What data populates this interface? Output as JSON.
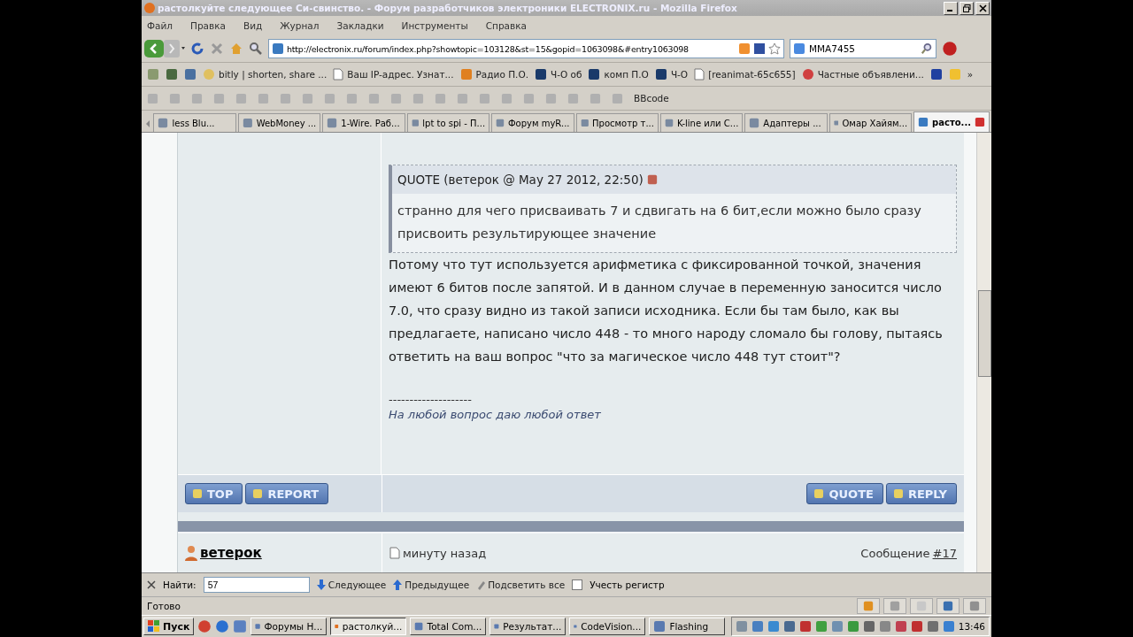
{
  "window": {
    "title": "растолкуйте следующее Си-свинство. - Форум разработчиков электроники ELECTRONIX.ru - Mozilla Firefox"
  },
  "menu": [
    "Файл",
    "Правка",
    "Вид",
    "Журнал",
    "Закладки",
    "Инструменты",
    "Справка"
  ],
  "nav": {
    "url": "http://electronix.ru/forum/index.php?showtopic=103128&st=15&gopid=1063098&#entry1063098",
    "search": "MMA7455"
  },
  "bookmarks": [
    "bitly | shorten, share ...",
    "Ваш IP-адрес. Узнат...",
    "Радио П.О.",
    "Ч-О  об",
    "комп П.О",
    "Ч-О",
    "[reanimat-65c655]",
    "Частные объявлени..."
  ],
  "bookmarks_more": "»",
  "format_toolbar": {
    "bbcode": "BBcode"
  },
  "tabs": [
    {
      "label": "less Blu...",
      "selected": false
    },
    {
      "label": "WebMoney ...",
      "selected": false
    },
    {
      "label": "1-Wire. Раб...",
      "selected": false
    },
    {
      "label": "lpt to spi - П...",
      "selected": false
    },
    {
      "label": "Форум myR...",
      "selected": false
    },
    {
      "label": "Просмотр т...",
      "selected": false
    },
    {
      "label": "K-line или C...",
      "selected": false
    },
    {
      "label": "Адаптеры ...",
      "selected": false
    },
    {
      "label": "Омар Хайям...",
      "selected": false
    },
    {
      "label": "расто...",
      "selected": true
    }
  ],
  "post": {
    "quote_header": "QUOTE (ветерок @ May 27 2012, 22:50)",
    "quote_text": "странно для чего присваивать 7 и сдвигать на 6 бит,если можно было сразу присвоить результирующее значение",
    "body": "Потому что тут используется арифметика с фиксированной точкой, значения имеют 6 битов после запятой. И в данном случае в переменную заносится число 7.0, что сразу видно из такой записи исходника. Если бы там было, как вы предлагаете, написано число 448 - то много народу сломало бы голову, пытаясь ответить на ваш вопрос \"что за магическое число 448 тут стоит\"?",
    "signature_rule": "--------------------",
    "signature": "На любой вопрос даю любой ответ",
    "left_buttons": [
      "TOP",
      "REPORT"
    ],
    "right_buttons": [
      "QUOTE",
      "REPLY"
    ]
  },
  "next_post": {
    "author": "ветерок",
    "time": "минуту назад",
    "message_label": "Сообщение",
    "message_number": "#17"
  },
  "find_bar": {
    "label": "Найти:",
    "value": "57",
    "next": "Следующее",
    "previous": "Предыдущее",
    "highlight": "Подсветить все",
    "match_case": {
      "label": "Учесть регистр",
      "checked": false
    }
  },
  "status": "Готово",
  "taskbar": {
    "start": "Пуск",
    "tasks": [
      {
        "label": "Форумы Н...",
        "selected": false
      },
      {
        "label": "растолкуй...",
        "selected": true
      },
      {
        "label": "Total Com...",
        "selected": false
      },
      {
        "label": "Результат...",
        "selected": false
      },
      {
        "label": "CodeVision...",
        "selected": false
      },
      {
        "label": "Flashing",
        "selected": false
      }
    ],
    "clock": "13:46"
  }
}
